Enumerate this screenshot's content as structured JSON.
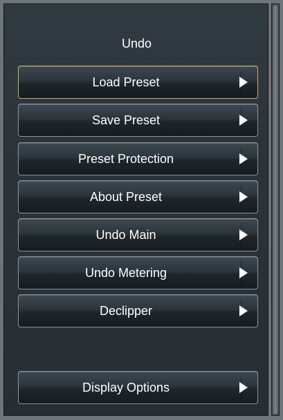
{
  "panel": {
    "title": "Undo"
  },
  "menu": {
    "items": [
      {
        "label": "Load Preset"
      },
      {
        "label": "Save Preset"
      },
      {
        "label": "Preset Protection"
      },
      {
        "label": "About Preset"
      },
      {
        "label": "Undo Main"
      },
      {
        "label": "Undo Metering"
      },
      {
        "label": "Declipper"
      }
    ],
    "footer_item": {
      "label": "Display Options"
    },
    "selected_item": "Load Preset"
  },
  "icons": {
    "submenu": "chevron-right-icon"
  },
  "colors": {
    "panel_bg": "#2a3238",
    "button_border": "#8d959b",
    "selected_border": "#c9b25c",
    "text": "#ffffff"
  }
}
